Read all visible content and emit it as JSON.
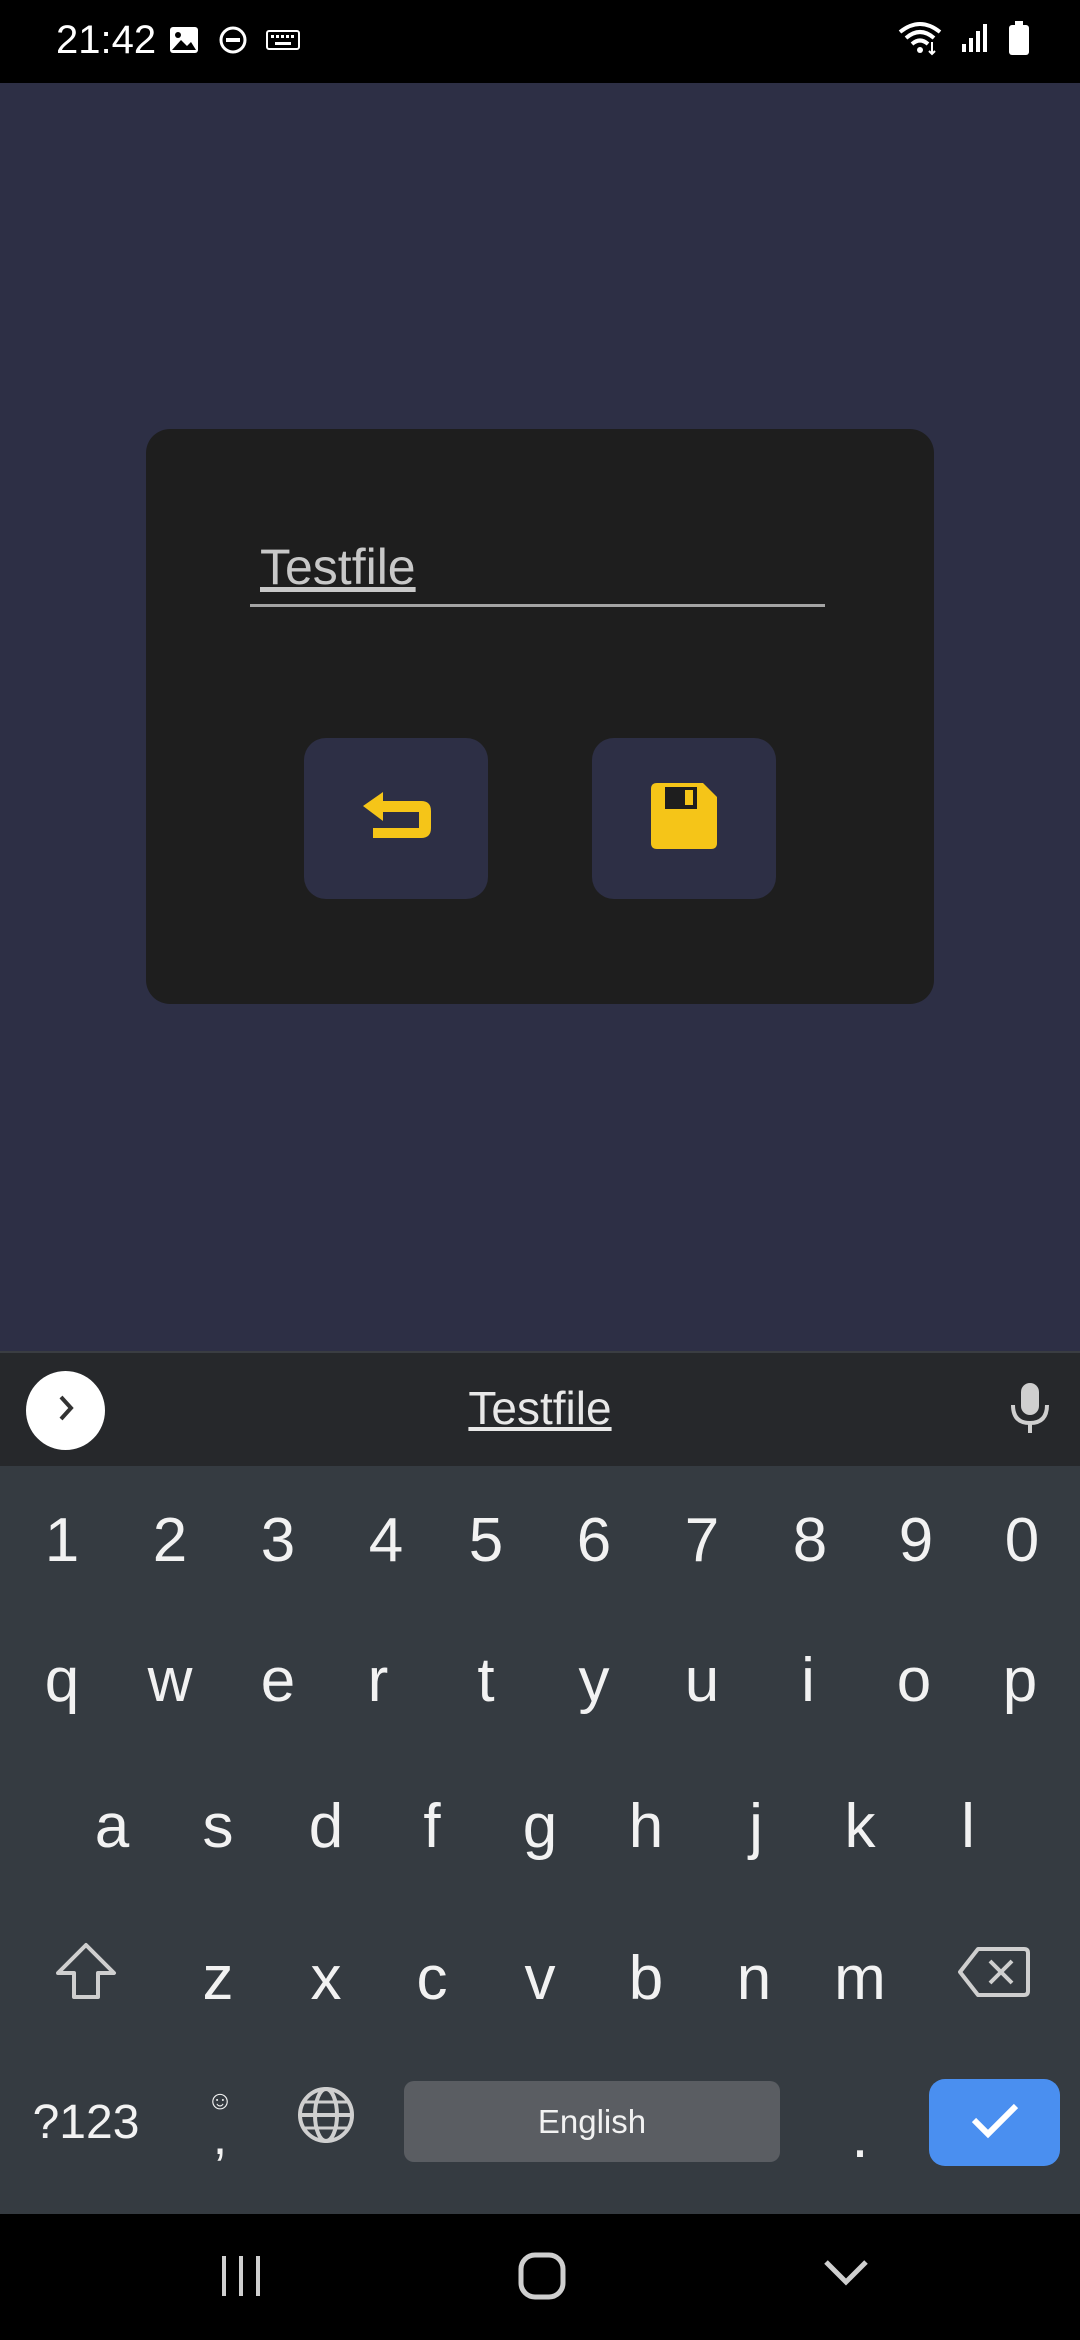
{
  "status_bar": {
    "time": "21:42",
    "left_icons": [
      "image-icon",
      "dnd-icon",
      "keyboard-icon"
    ],
    "right_icons": [
      "wifi-icon",
      "signal-icon",
      "battery-icon"
    ]
  },
  "dialog": {
    "filename_value": "Testfile",
    "back_button_icon": "undo-return-icon",
    "save_button_icon": "save-floppy-icon",
    "accent_color": "#f5c518"
  },
  "keyboard": {
    "suggestion": "Testfile",
    "number_row": [
      "1",
      "2",
      "3",
      "4",
      "5",
      "6",
      "7",
      "8",
      "9",
      "0"
    ],
    "row1": [
      "q",
      "w",
      "e",
      "r",
      "t",
      "y",
      "u",
      "i",
      "o",
      "p"
    ],
    "row2": [
      "a",
      "s",
      "d",
      "f",
      "g",
      "h",
      "j",
      "k",
      "l"
    ],
    "row3": [
      "z",
      "x",
      "c",
      "v",
      "b",
      "n",
      "m"
    ],
    "symbols_key": "?123",
    "comma_key": ",",
    "space_label": "English",
    "period_key": ".",
    "enter_color": "#4a8ff0"
  },
  "nav_bar": {
    "icons": [
      "recents-icon",
      "home-icon",
      "back-icon"
    ]
  }
}
